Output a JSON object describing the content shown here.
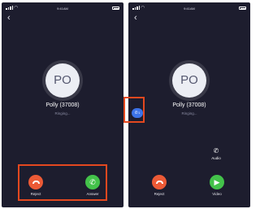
{
  "status_bar": {
    "time": "9:41AM"
  },
  "accent_colors": {
    "reject": "#ec5a36",
    "answer": "#43c24a",
    "float": "#3d73e8",
    "highlight": "#e3481f",
    "background": "#1d1d2e"
  },
  "left_screen": {
    "back_icon": "chevron-left-icon",
    "avatar_initials": "PO",
    "caller_name": "Polly (37008)",
    "call_status": "Ringing...",
    "reject_label": "Reject",
    "answer_label": "Answer"
  },
  "right_screen": {
    "back_icon": "chevron-left-icon",
    "avatar_initials": "PO",
    "caller_name": "Polly (37008)",
    "call_status": "Ringing...",
    "floating_button_count": "1",
    "audio_label": "Audio",
    "reject_label": "Reject",
    "video_label": "Video"
  }
}
